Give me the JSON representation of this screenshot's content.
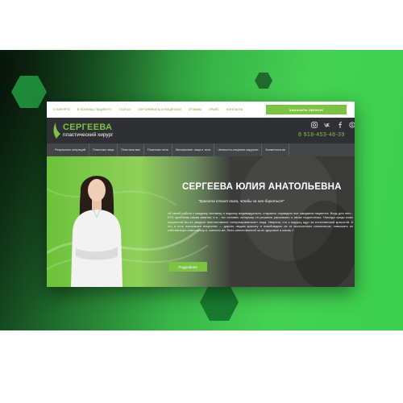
{
  "colors": {
    "accent": "#7cc243",
    "header_bg": "#2f3033",
    "menu_bg": "#444548",
    "band_green": "#45d152"
  },
  "top_nav": {
    "links": [
      "О ХИРУРГЕ",
      "В ПОМОЩЬ ПАЦИЕНТУ",
      "СТАТЬИ",
      "СЕРТИФИКАТЫ И ЛИЦЕНЗИИ",
      "ОТЗЫВЫ",
      "ПРАЙС",
      "КОНТАКТЫ"
    ],
    "call_button": "ЗАКАЗАТЬ ЗВОНОК"
  },
  "header": {
    "logo_title": "СЕРГЕЕВА",
    "logo_subtitle": "пластический хирург",
    "phone": "8 918-453-48-39",
    "social_icons": [
      "instagram-icon",
      "vk-icon",
      "facebook-icon",
      "skype-icon"
    ]
  },
  "menu": {
    "items": [
      "Результаты операций",
      "Пластика лица",
      "Пластика век",
      "Пластика тела",
      "Липофилинг лица и тела",
      "Челюстно-лицевая хирургия",
      "Косметология"
    ]
  },
  "hero": {
    "name": "СЕРГЕЕВА ЮЛИЯ АНАТОЛЬЕВНА",
    "quote": "\"Красота стоит того, чтобы за нее бороться!\"",
    "text": "«В своей работе к каждому человеку я подхожу индивидуально, стараюсь оправдать все ожидания пациента. Ведь для него - ЕГО проблема самая важная, а я - тот человек, которому он решился рассказать о своих недостатках. Никогда среди моих пациентов Вы не увидите неестественно «опереированные» лица. Уверена, что к хирургу идут за естественной красотой. А это и есть настоящее искусство — дарить людям красоту и освобождать их от многолетних комплексов, повышать их собственную самооценку и, конечно же, быть ответственной за их здоровье и жизнь.»",
    "more_button": "Подробнее"
  }
}
